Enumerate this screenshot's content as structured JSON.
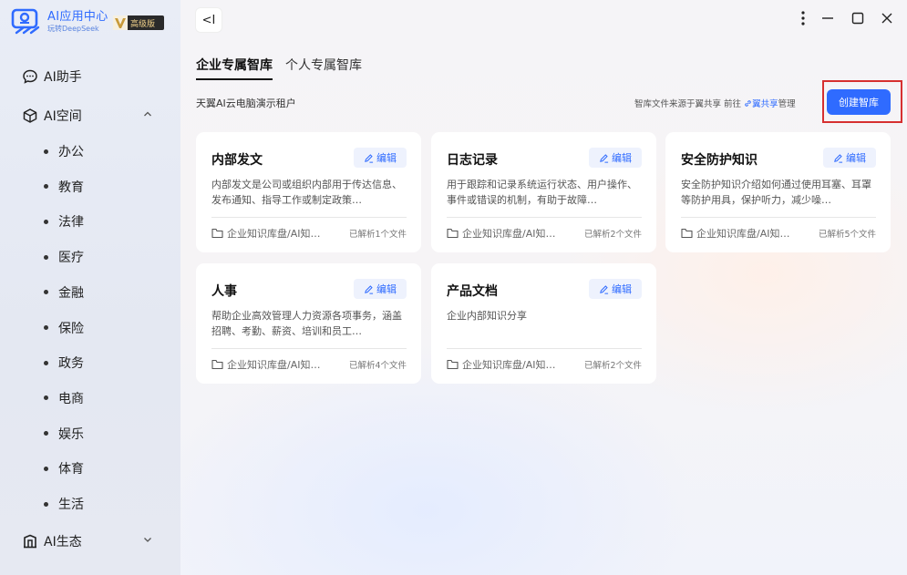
{
  "app": {
    "logo_title": "AI应用中心",
    "logo_sub": "玩转DeepSeek",
    "vip_badge": "高级版",
    "brand_color": "#2f6bff",
    "highlight_color": "#d63030"
  },
  "sidebar": {
    "assistant": "AI助手",
    "space": "AI空间",
    "categories": [
      "办公",
      "教育",
      "法律",
      "医疗",
      "金融",
      "保险",
      "政务",
      "电商",
      "娱乐",
      "体育",
      "生活"
    ],
    "ecosystem": "AI生态"
  },
  "header": {
    "collapse_label": "<I"
  },
  "tabs": [
    {
      "label": "企业专属智库",
      "active": true
    },
    {
      "label": "个人专属智库",
      "active": false
    }
  ],
  "toolbar": {
    "tenant": "天翼AI云电脑演示租户",
    "source_prefix": "智库文件来源于翼共享 前往",
    "source_link": "翼共享",
    "source_suffix": "管理",
    "create_label": "创建智库"
  },
  "cards": [
    {
      "title": "内部发文",
      "edit": "编辑",
      "desc": "内部发文是公司或组织内部用于传达信息、发布通知、指导工作或制定政策…",
      "path": "企业知识库盘/AI知…",
      "count": "已解析1个文件"
    },
    {
      "title": "日志记录",
      "edit": "编辑",
      "desc": "用于跟踪和记录系统运行状态、用户操作、事件或错误的机制，有助于故障…",
      "path": "企业知识库盘/AI知…",
      "count": "已解析2个文件"
    },
    {
      "title": "安全防护知识",
      "edit": "编辑",
      "desc": "安全防护知识介绍如何通过使用耳塞、耳罩等防护用具，保护听力，减少噪…",
      "path": "企业知识库盘/AI知…",
      "count": "已解析5个文件"
    },
    {
      "title": "人事",
      "edit": "编辑",
      "desc": "帮助企业高效管理人力资源各项事务，涵盖招聘、考勤、薪资、培训和员工…",
      "path": "企业知识库盘/AI知…",
      "count": "已解析4个文件"
    },
    {
      "title": "产品文档",
      "edit": "编辑",
      "desc": "企业内部知识分享",
      "path": "企业知识库盘/AI知…",
      "count": "已解析2个文件"
    }
  ]
}
